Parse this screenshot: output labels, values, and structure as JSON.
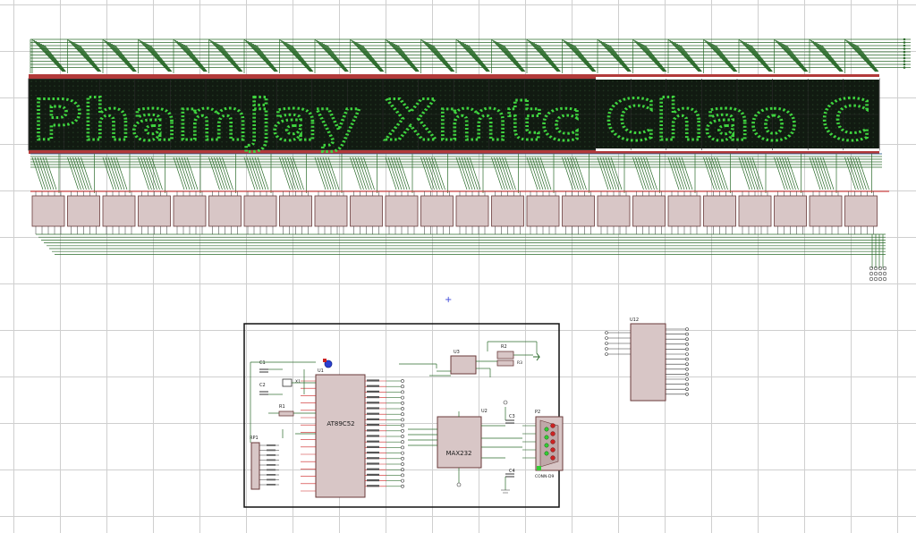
{
  "display": {
    "text": "Phamjay Xmtc Chao C",
    "lit_color": "#3fd43f",
    "panel_color": "#111a11"
  },
  "mcu": {
    "part": "AT89C52",
    "ref": "U1"
  },
  "rs232": {
    "part": "MAX232",
    "ref": "U2"
  },
  "connector": {
    "ref": "P2",
    "part": "CONN-D9"
  },
  "resistor_pack": {
    "ref": "RP1"
  },
  "decoder": {
    "ref": "U12"
  },
  "crystal": {
    "ref": "X1"
  },
  "caps": {
    "c1": "C1",
    "c2": "C2",
    "c3": "C3",
    "c4": "C4"
  },
  "resistors": {
    "r1": "R1",
    "r2": "R2",
    "r3": "R3"
  },
  "regulator": {
    "ref": "U3"
  },
  "colors": {
    "wire": "#2b6b2b",
    "component_fill": "#d8c6c6",
    "component_stroke": "#6a3a3a",
    "grid": "#cfcfcf",
    "pin_red": "#c22",
    "pin_blue": "#2b50d0"
  }
}
